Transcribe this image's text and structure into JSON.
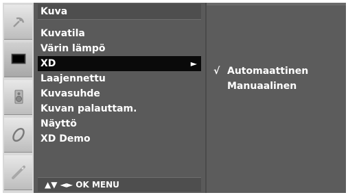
{
  "menu": {
    "title": "Kuva",
    "items": [
      {
        "label": "Kuvatila"
      },
      {
        "label": "Värin lämpö"
      },
      {
        "label": "XD",
        "arrow": "►"
      },
      {
        "label": "Laajennettu"
      },
      {
        "label": "Kuvasuhde"
      },
      {
        "label": "Kuvan palauttam."
      },
      {
        "label": "Näyttö"
      },
      {
        "label": "XD Demo"
      }
    ],
    "selected_index": 2
  },
  "submenu": {
    "items": [
      {
        "label": "Automaattinen",
        "check": "√"
      },
      {
        "label": "Manuaalinen",
        "check": ""
      }
    ]
  },
  "nav_hint": "▲▼  ◄►  OK  MENU",
  "icons": [
    "satellite-icon",
    "picture-icon",
    "speaker-icon",
    "disc-icon",
    "tag-icon"
  ]
}
